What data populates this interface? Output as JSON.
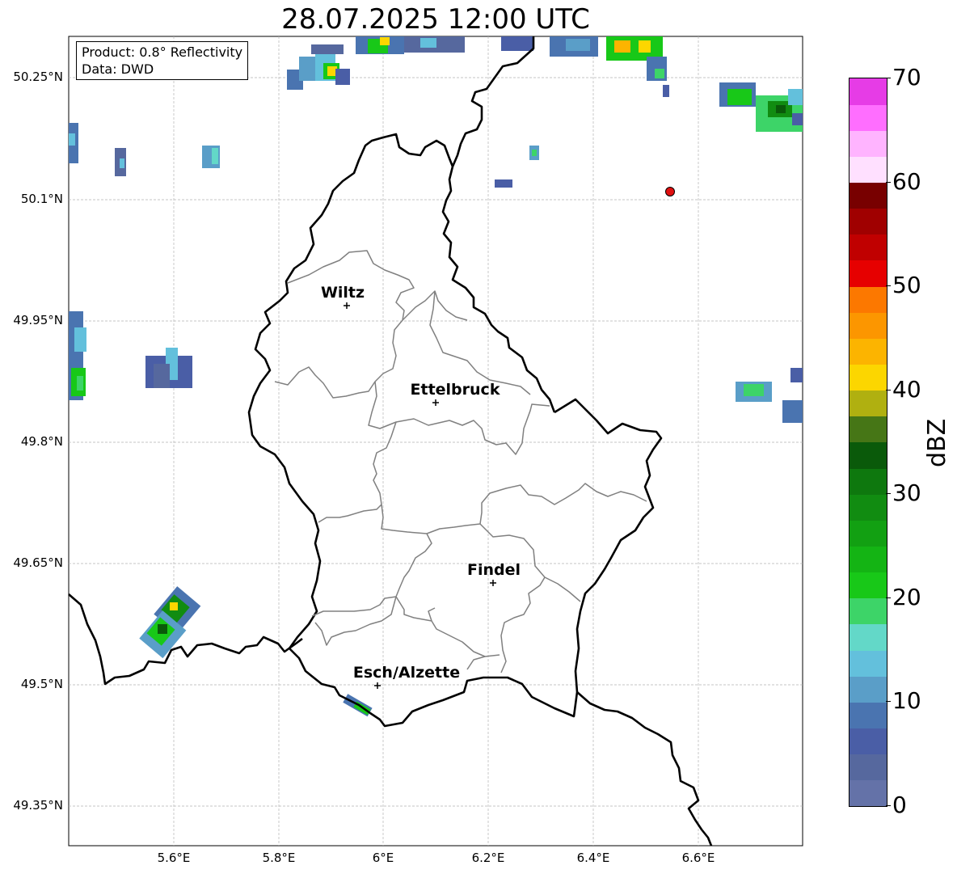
{
  "title": "28.07.2025 12:00 UTC",
  "info_box": {
    "product": "Product: 0.8° Reflectivity",
    "data": "Data: DWD"
  },
  "lat_labels": [
    "50.25°N",
    "50.1°N",
    "49.95°N",
    "49.8°N",
    "49.65°N",
    "49.5°N",
    "49.35°N"
  ],
  "lon_labels": [
    "5.6°E",
    "5.8°E",
    "6°E",
    "6.2°E",
    "6.4°E",
    "6.6°E"
  ],
  "cities": [
    {
      "name": "Wiltz"
    },
    {
      "name": "Ettelbruck"
    },
    {
      "name": "Findel"
    },
    {
      "name": "Esch/Alzette"
    }
  ],
  "colorbar": {
    "unit": "dBZ",
    "tick_labels": [
      "0",
      "10",
      "20",
      "30",
      "40",
      "50",
      "60",
      "70"
    ],
    "colors": [
      "#6472a8",
      "#56689e",
      "#4a5ea6",
      "#4a74b0",
      "#5a9ec8",
      "#63c0dc",
      "#63d8c8",
      "#3dd468",
      "#18c818",
      "#14b414",
      "#12a012",
      "#118c11",
      "#0e780e",
      "#0a5a0a",
      "#467616",
      "#b0b010",
      "#fcd600",
      "#fcb400",
      "#fc9600",
      "#fc7800",
      "#e60000",
      "#c00000",
      "#a00000",
      "#780000",
      "#ffe0ff",
      "#ffb4ff",
      "#ff6eff",
      "#e63ce6"
    ]
  },
  "marker_color": "#e01010"
}
